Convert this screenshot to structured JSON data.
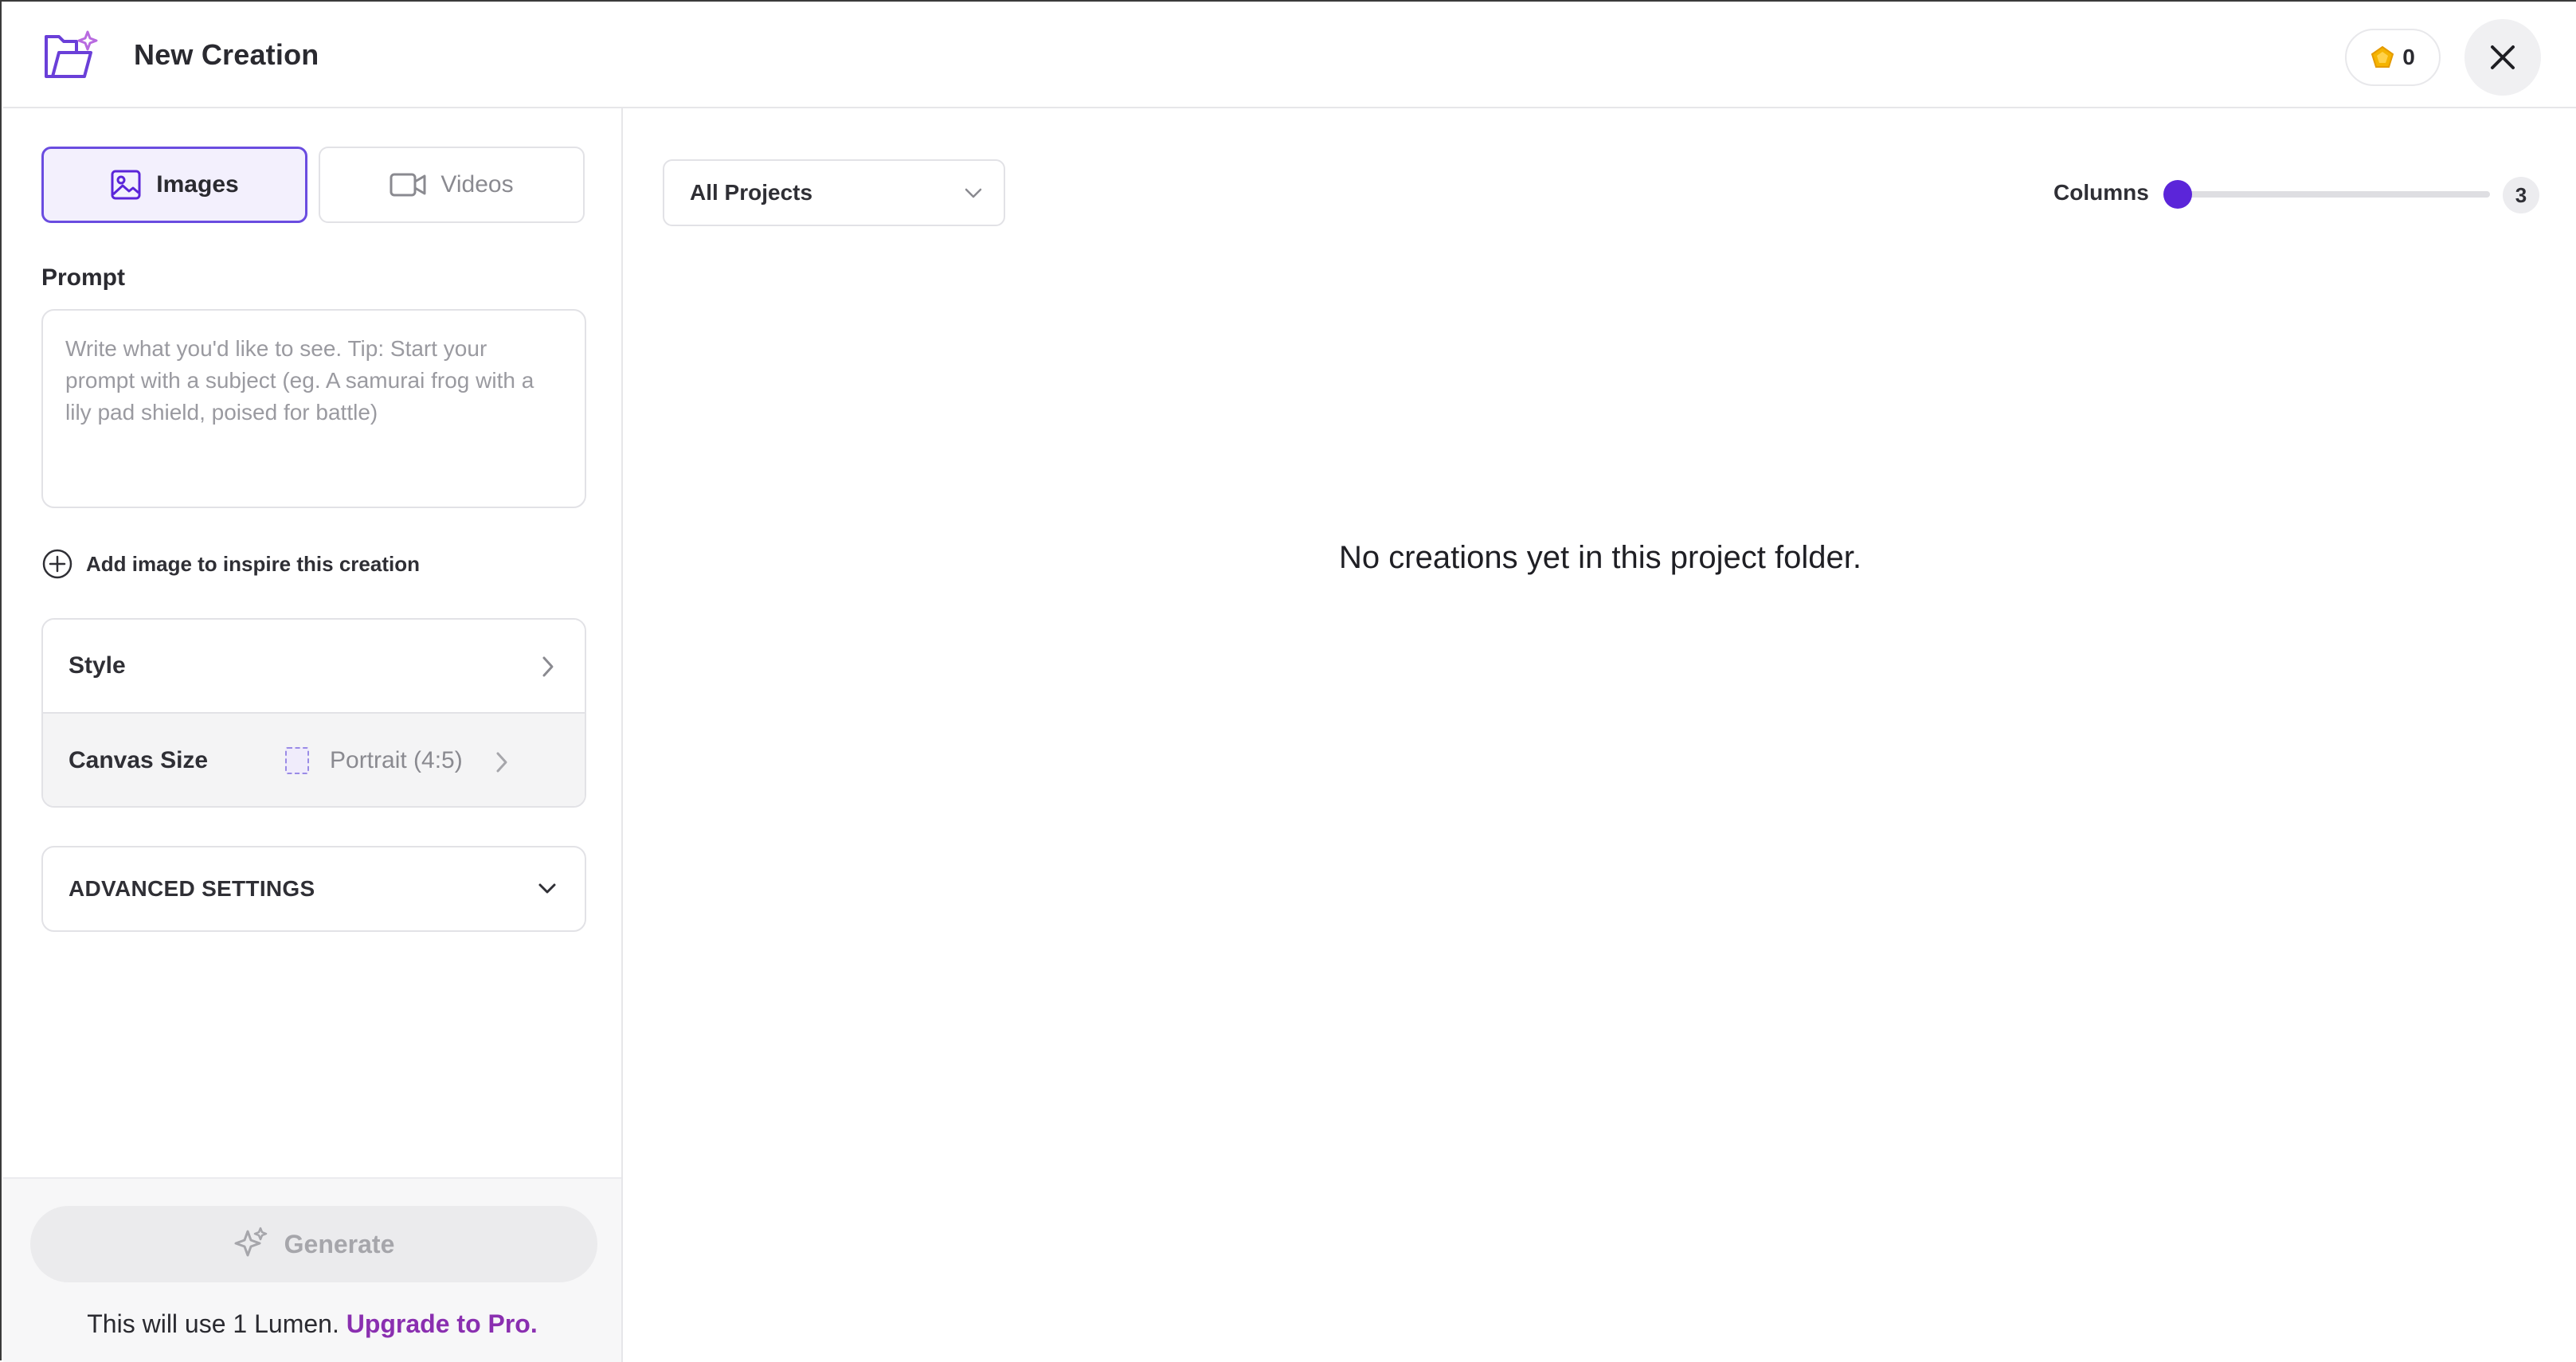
{
  "header": {
    "title": "New Creation",
    "lumens_count": "0",
    "logo_icon": "folder-sparkle-icon",
    "close_icon": "close-icon"
  },
  "sidebar": {
    "tabs": [
      {
        "label": "Images",
        "icon": "image-icon",
        "selected": true
      },
      {
        "label": "Videos",
        "icon": "video-camera-icon",
        "selected": false
      }
    ],
    "prompt": {
      "label": "Prompt",
      "value": "",
      "placeholder": "Write what you'd like to see.  Tip: Start your prompt with a subject (eg. A samurai frog with a lily pad shield, poised for battle)"
    },
    "add_image_label": "Add image to inspire this creation",
    "style": {
      "label": "Style"
    },
    "canvas_size": {
      "label": "Canvas Size",
      "value": "Portrait (4:5)"
    },
    "advanced_settings": {
      "label": "ADVANCED SETTINGS"
    },
    "generate": {
      "label": "Generate",
      "disabled": true
    },
    "usage": {
      "text": "This will use 1 Lumen. ",
      "link": "Upgrade to Pro."
    }
  },
  "main": {
    "project_filter": "All Projects",
    "columns": {
      "label": "Columns",
      "value": "3"
    },
    "empty_message": "No creations yet in this project folder."
  },
  "colors": {
    "accent": "#5b25d9",
    "tab_selected_border": "#6a4ce0",
    "tab_selected_bg": "#f3f0fd",
    "upgrade_link": "#8a2fb0",
    "lumen_gem": "#f5b400"
  }
}
